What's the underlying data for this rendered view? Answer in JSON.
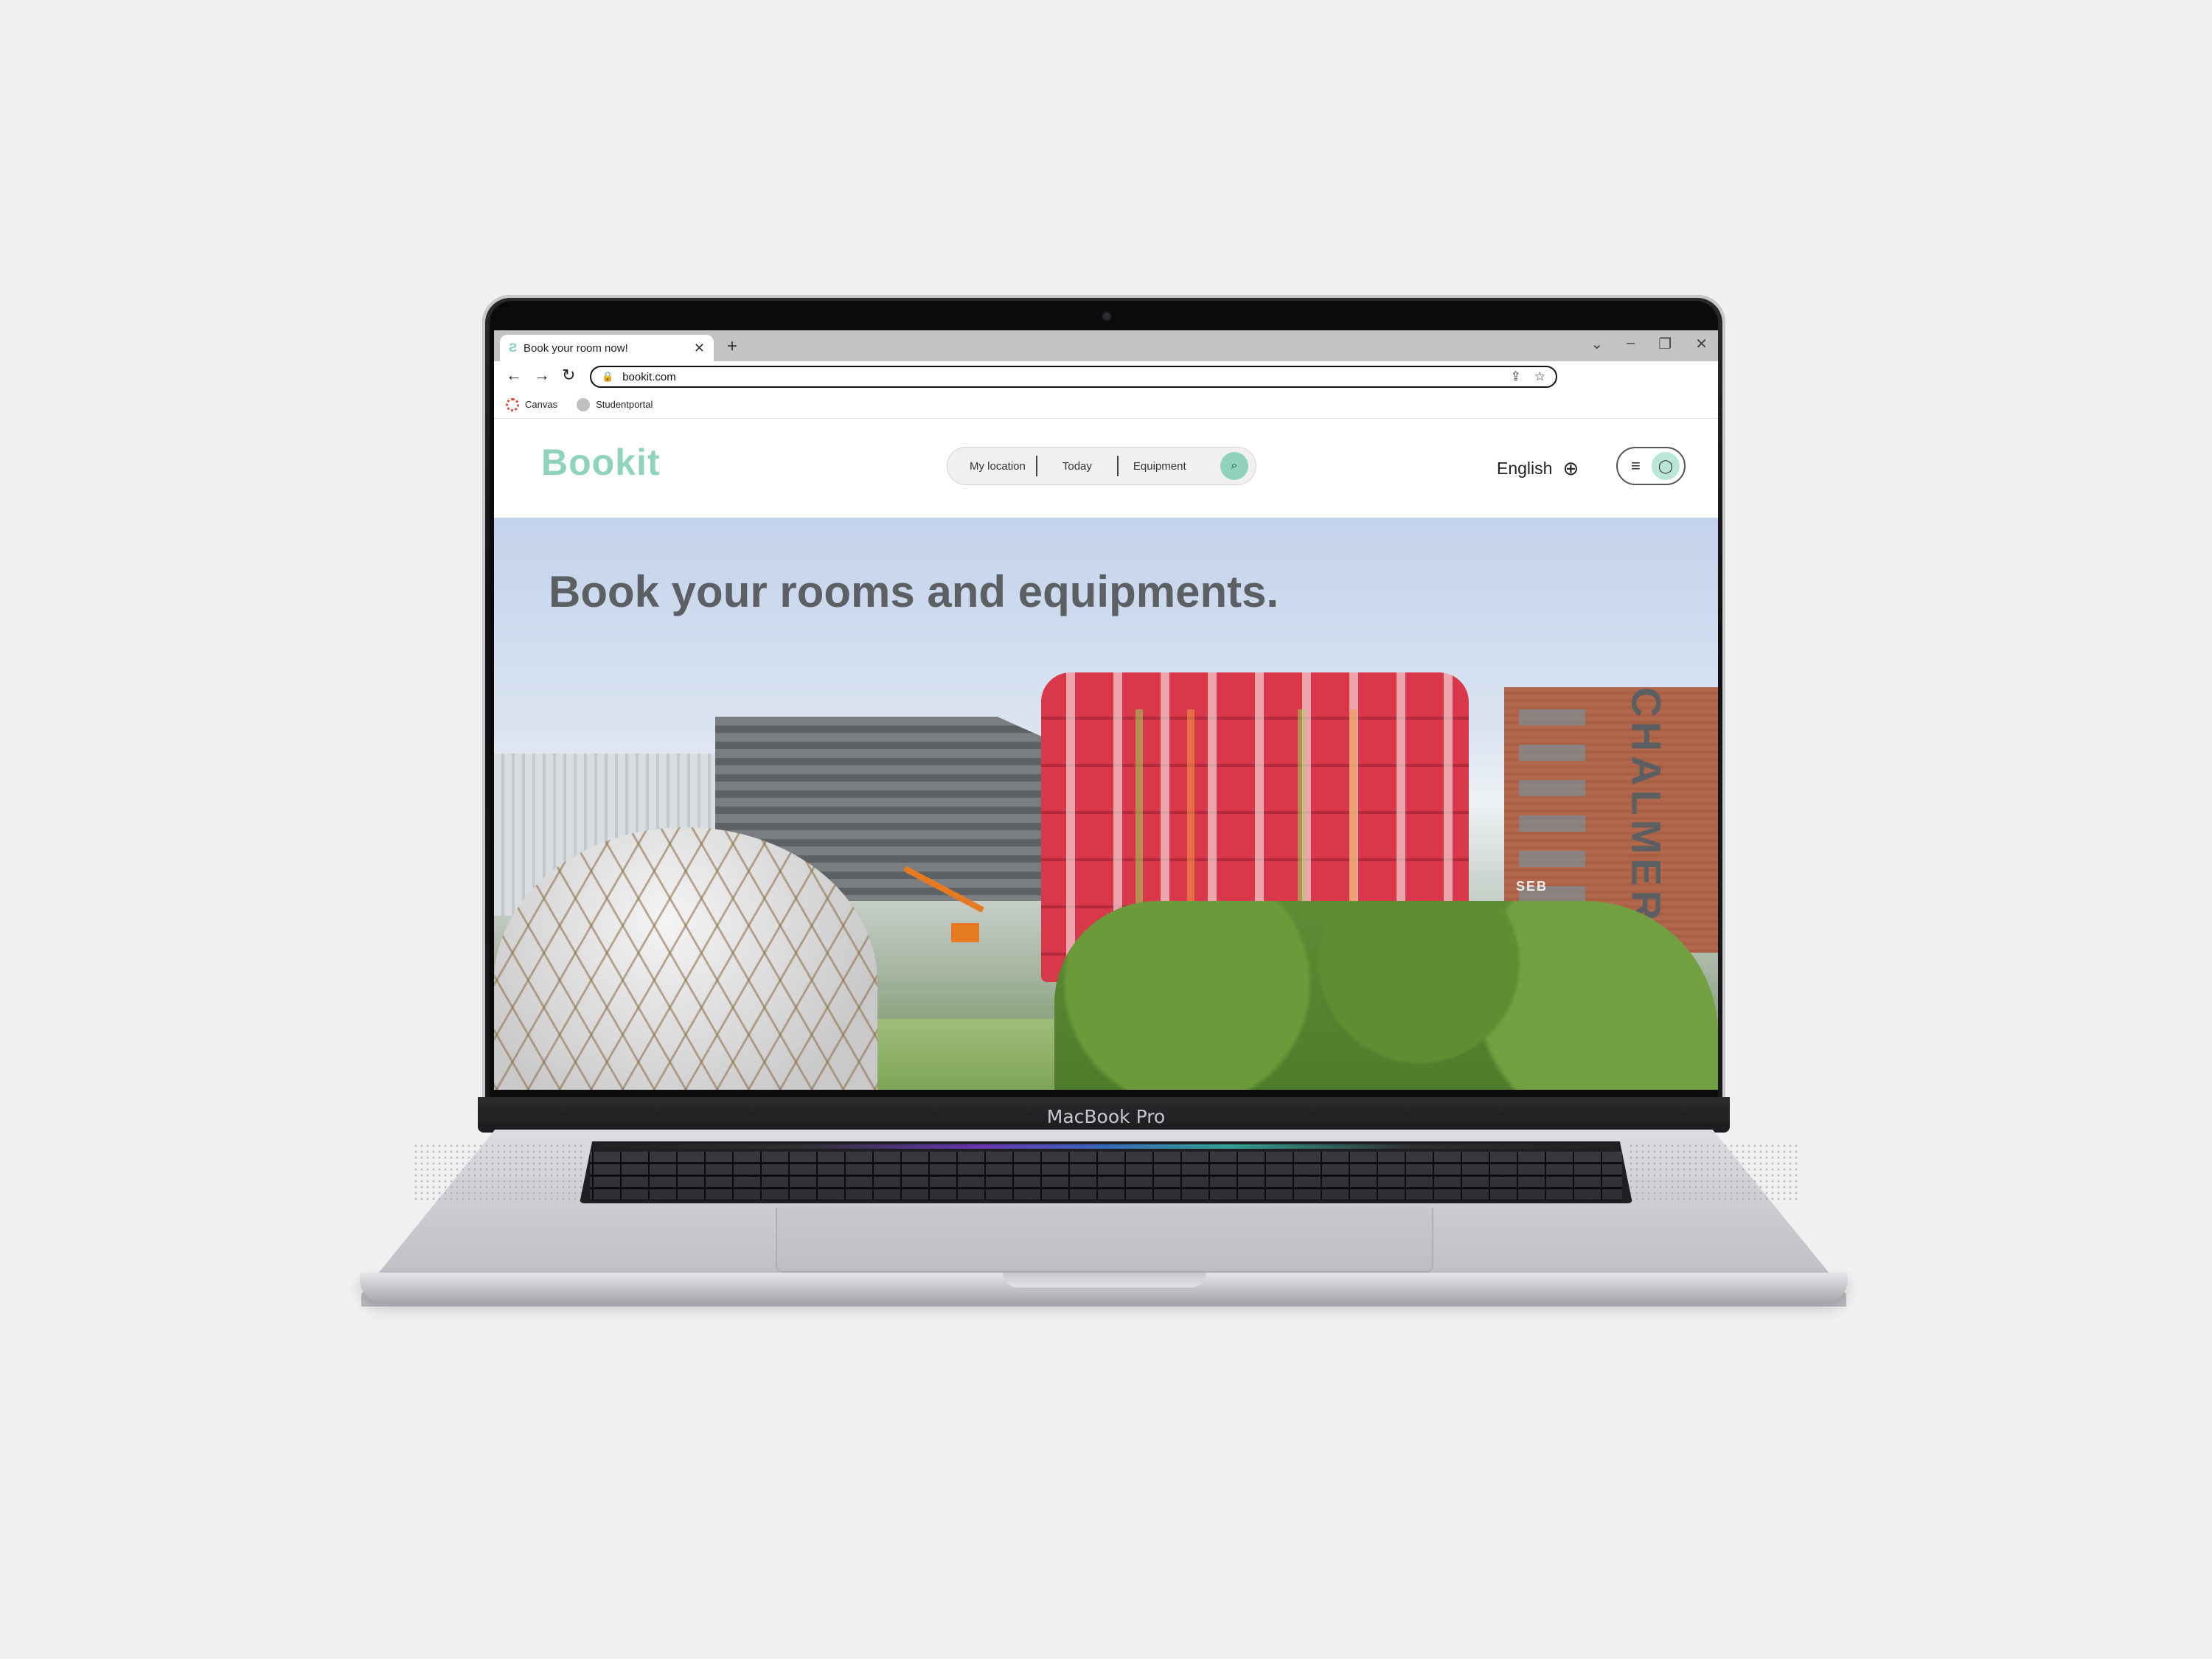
{
  "device": {
    "label": "MacBook Pro"
  },
  "browser": {
    "tab": {
      "favicon": "Ƨ",
      "title": "Book your room now!",
      "close_icon": "close-icon"
    },
    "new_tab_icon": "plus-icon",
    "window_controls": [
      "chevron-down-icon",
      "minimize-icon",
      "restore-icon",
      "close-icon"
    ],
    "url": "bookit.com",
    "bookmarks": [
      {
        "label": "Canvas",
        "icon": "canvas-icon"
      },
      {
        "label": "Studentportal",
        "icon": "studentportal-icon"
      }
    ]
  },
  "site": {
    "logo": "Bookit",
    "search": {
      "items": [
        "My location",
        "Today",
        "Equipment"
      ],
      "icon": "search-icon"
    },
    "language": "English",
    "hero": {
      "heading": "Book your rooms and equipments.",
      "building_sign": "CHALMERS",
      "bank_sign": "SEB"
    }
  },
  "colors": {
    "accent": "#8fd3bd",
    "heading": "#5c6062",
    "tower": "#d13b4d"
  }
}
